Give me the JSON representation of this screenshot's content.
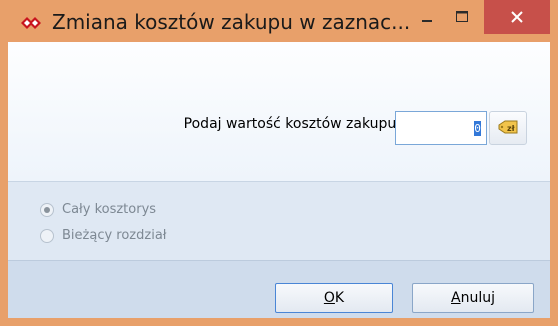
{
  "window": {
    "title": "Zmiana kosztów zakupu w zaznac...",
    "icon": "red-double-arrow-app-icon",
    "controls": [
      "minimize-icon",
      "maximize-icon",
      "close-icon"
    ]
  },
  "form": {
    "cost_label": "Podaj wartość kosztów zakupu:",
    "cost_value": "0",
    "calc_button_icon": "currency-calculator-icon"
  },
  "scope": {
    "options": [
      {
        "label": "Cały kosztorys",
        "selected": true,
        "enabled": false
      },
      {
        "label": "Bieżący rozdział",
        "selected": false,
        "enabled": false
      }
    ]
  },
  "buttons": {
    "ok_mnemonic": "O",
    "ok_rest": "K",
    "cancel_mnemonic": "A",
    "cancel_rest": "nuluj"
  },
  "colors": {
    "titlebar": "#e8a06a",
    "close": "#c7504a",
    "input_border": "#7aa7d8",
    "selection": "#3378d8"
  }
}
